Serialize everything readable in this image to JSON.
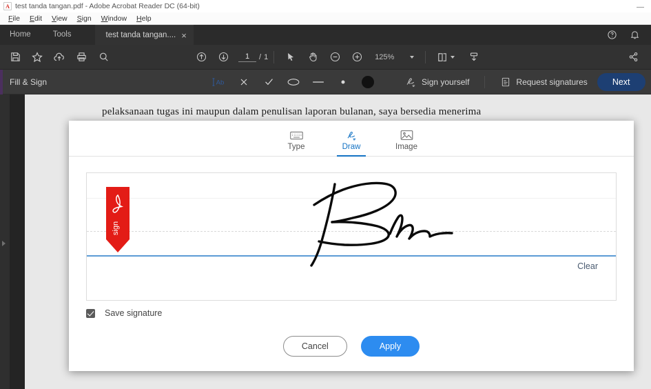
{
  "window": {
    "title": "test tanda tangan.pdf - Adobe Acrobat Reader DC (64-bit)",
    "logo_icon": "acrobat-logo-icon",
    "minimize_icon": "minimize-icon"
  },
  "menubar": {
    "items": [
      {
        "label": "File",
        "mnemonic": "F"
      },
      {
        "label": "Edit",
        "mnemonic": "E"
      },
      {
        "label": "View",
        "mnemonic": "V"
      },
      {
        "label": "Sign",
        "mnemonic": "S"
      },
      {
        "label": "Window",
        "mnemonic": "W"
      },
      {
        "label": "Help",
        "mnemonic": "H"
      }
    ]
  },
  "tabstrip": {
    "home_label": "Home",
    "tools_label": "Tools",
    "doc_tab_label": "test tanda tangan....",
    "doc_tab_close": "×",
    "help_icon": "help-circle-icon",
    "bell_icon": "notification-bell-icon"
  },
  "toolbar": {
    "save_icon": "save-icon",
    "star_icon": "star-icon",
    "upload_icon": "upload-cloud-icon",
    "print_icon": "print-icon",
    "search_icon": "search-icon",
    "page_up_icon": "page-up-icon",
    "page_down_icon": "page-down-icon",
    "page_current": "1",
    "page_separator": "/",
    "page_total": "1",
    "cursor_icon": "select-cursor-icon",
    "hand_icon": "hand-tool-icon",
    "zoom_out_icon": "zoom-out-icon",
    "zoom_in_icon": "zoom-in-icon",
    "zoom_level": "125%",
    "fit_page_icon": "fit-page-icon",
    "scroll_mode_icon": "scroll-mode-icon",
    "share_icon": "share-icon"
  },
  "fillsign": {
    "title": "Fill & Sign",
    "text_icon": "add-text-icon",
    "cross_icon": "cross-mark-icon",
    "check_icon": "check-mark-icon",
    "ellipse_icon": "ellipse-icon",
    "line_icon": "line-icon",
    "dot_icon": "dot-icon",
    "color_swatch": "color-swatch-black",
    "color_swatch_hex": "#111111",
    "sign_yourself_label": "Sign yourself",
    "sign_yourself_icon": "sign-pen-icon",
    "request_signatures_label": "Request signatures",
    "request_signatures_icon": "request-doc-icon",
    "next_label": "Next",
    "next_color": "#1d3f73"
  },
  "document": {
    "body_text": "pelaksanaan tugas ini maupun dalam penulisan laporan bulanan, saya bersedia menerima",
    "rail_expand_icon": "expand-panel-arrow-icon"
  },
  "dialog": {
    "tabs": [
      {
        "label": "Type",
        "icon": "keyboard-icon",
        "active": false
      },
      {
        "label": "Draw",
        "icon": "draw-pen-icon",
        "active": true
      },
      {
        "label": "Image",
        "icon": "image-picture-icon",
        "active": false
      }
    ],
    "canvas": {
      "sign_marker_icon": "sign-here-marker-icon",
      "sign_marker_text": "sign",
      "signature_icon": "handwritten-signature-icon",
      "baseline_color": "#5b9bd5"
    },
    "clear_label": "Clear",
    "clear_color": "#4a5b70",
    "save_signature_label": "Save signature",
    "save_signature_checked": true,
    "cancel_label": "Cancel",
    "apply_label": "Apply",
    "apply_color": "#2d8cf0"
  }
}
